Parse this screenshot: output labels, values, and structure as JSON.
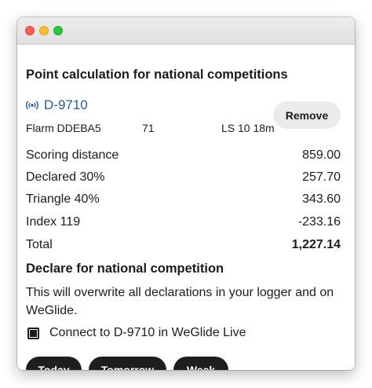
{
  "window": {
    "title_buttons": [
      "close",
      "minimize",
      "maximize"
    ]
  },
  "point_calc": {
    "heading": "Point calculation for national competitions",
    "glider": {
      "icon": "antenna-icon",
      "registration": "D-9710",
      "flarm": "Flarm DDEBA5",
      "number": "71",
      "class_info": "LS 10 18m"
    },
    "remove_label": "Remove",
    "rows": [
      {
        "label": "Scoring distance",
        "value": "859.00"
      },
      {
        "label": "Declared 30%",
        "value": "257.70"
      },
      {
        "label": "Triangle 40%",
        "value": "343.60"
      },
      {
        "label": "Index 119",
        "value": "-233.16"
      },
      {
        "label": "Total",
        "value": "1,227.14"
      }
    ]
  },
  "declare": {
    "heading": "Declare for national competition",
    "description": "This will overwrite all declarations in your logger and on WeGlide.",
    "connect_label": "Connect to D-9710 in WeGlide Live",
    "connect_checked": true,
    "buttons": {
      "today": "Today",
      "tomorrow": "Tomorrow",
      "week": "Week"
    }
  },
  "colors": {
    "link": "#2858a8",
    "pill_bg": "#1e1e1e",
    "remove_bg": "#ebebeb"
  }
}
